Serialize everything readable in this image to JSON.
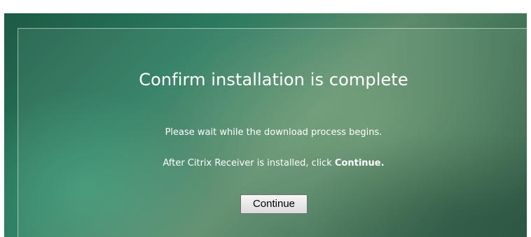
{
  "dialog": {
    "title": "Confirm installation is complete",
    "message_wait": "Please wait while the download process begins.",
    "message_after_prefix": "After Citrix Receiver is installed, click ",
    "message_after_emphasis": "Continue.",
    "continue_button_label": "Continue"
  },
  "colors": {
    "background_green": "#2b7a60",
    "text": "#ffffff",
    "button_face": "#e6e6e6"
  }
}
